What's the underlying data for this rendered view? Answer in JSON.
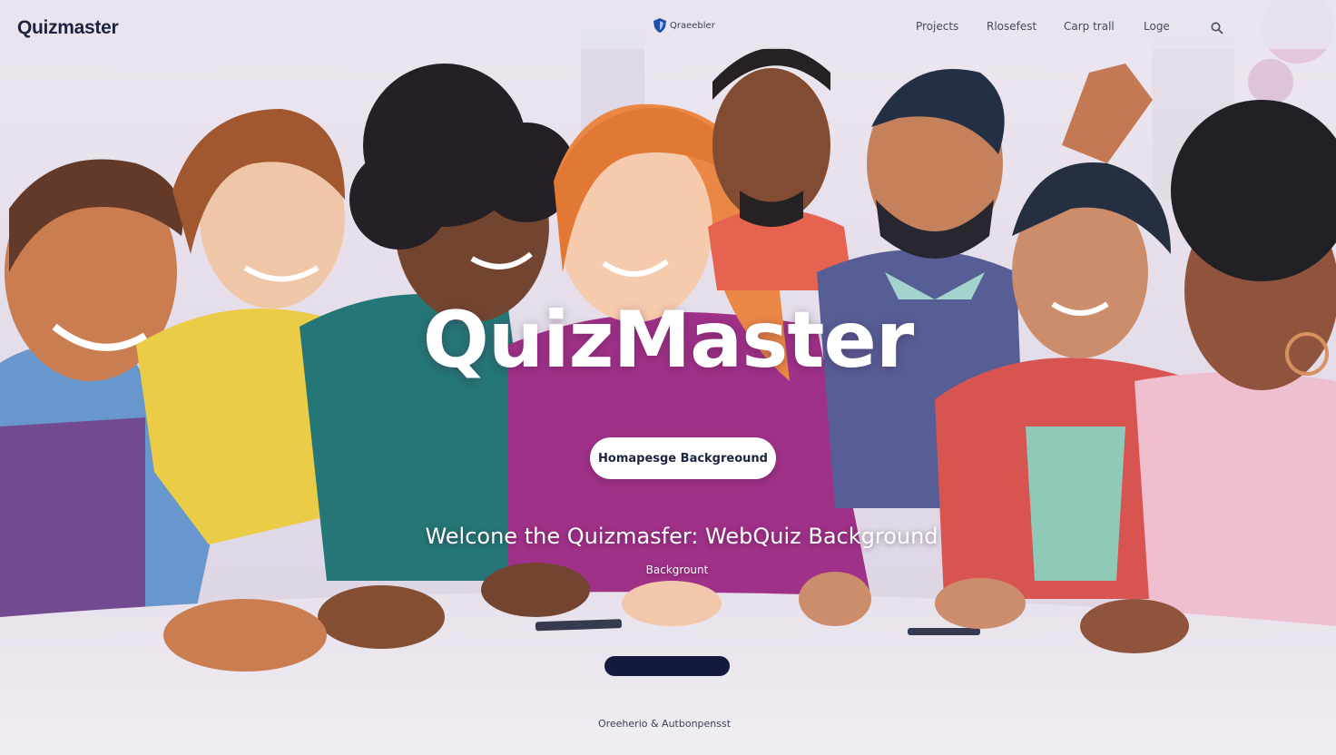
{
  "header": {
    "logo": "Quizmaster",
    "brand_label": "Qraeebler",
    "nav": [
      {
        "label": "Projects"
      },
      {
        "label": "Rlosefest"
      },
      {
        "label": "Carp trall"
      },
      {
        "label": "Loge"
      }
    ],
    "search_icon": "search-icon"
  },
  "hero": {
    "title": "QuizMaster",
    "button_label": "Homapesge Backgreound",
    "subtitle": "Welcone the Quizmasfer: WebQuiz Background",
    "caption": "Backgrount"
  },
  "footer": {
    "text": "Oreeherio & Autbonpensst"
  },
  "colors": {
    "accent": "#141a3c",
    "logo": "#1c2440",
    "hero_text": "#ffffff"
  }
}
